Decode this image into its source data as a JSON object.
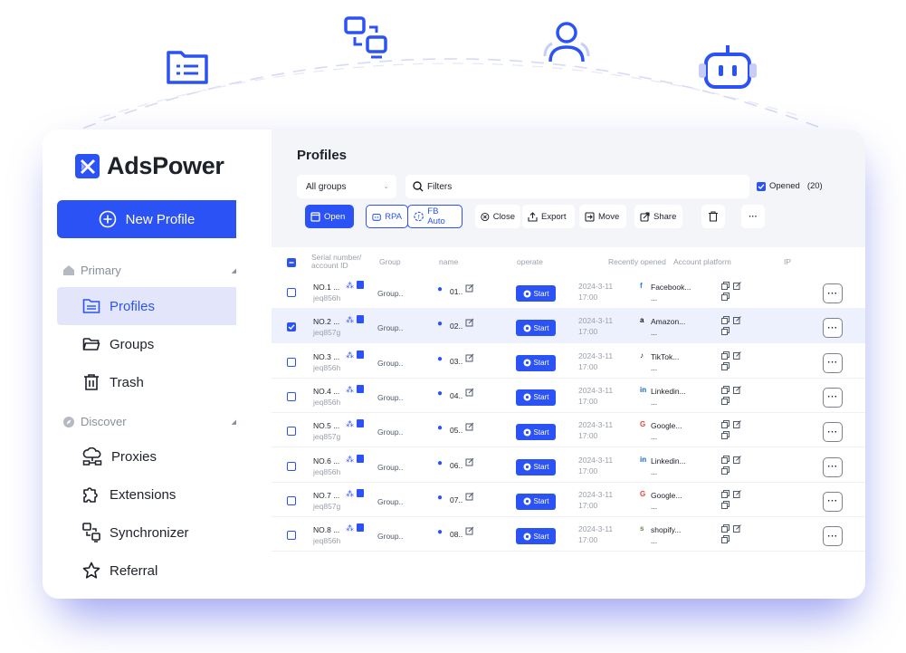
{
  "brand": {
    "name": "AdsPower",
    "color": "#2b52f5"
  },
  "top_icons": [
    "folder-list-icon",
    "sync-windows-icon",
    "user-icon",
    "robot-icon"
  ],
  "sidebar": {
    "new_profile": "New Profile",
    "sections": [
      {
        "label": "Primary",
        "icon": "home-icon"
      },
      {
        "label": "Discover",
        "icon": "compass-icon"
      }
    ],
    "primary_items": [
      {
        "label": "Profiles",
        "icon": "folder-icon",
        "active": true
      },
      {
        "label": "Groups",
        "icon": "open-folder-icon"
      },
      {
        "label": "Trash",
        "icon": "trash-icon"
      }
    ],
    "discover_items": [
      {
        "label": "Proxies",
        "icon": "cloud-network-icon"
      },
      {
        "label": "Extensions",
        "icon": "puzzle-icon"
      },
      {
        "label": "Synchronizer",
        "icon": "sync-windows-icon"
      },
      {
        "label": "Referral",
        "icon": "star-icon"
      }
    ]
  },
  "main": {
    "title": "Profiles",
    "group_select": "All groups",
    "filters_placeholder": "Filters",
    "opened_label": "Opened",
    "opened_count": "(20)",
    "toolbar": {
      "open": "Open",
      "rpa": "RPA",
      "fb_auto": "FB Auto",
      "close": "Close",
      "export": "Export",
      "move": "Move",
      "share": "Share",
      "more": "···"
    }
  },
  "table": {
    "headers": {
      "serial": "Serial number/\naccount ID",
      "group": "Group",
      "name": "name",
      "operate": "operate",
      "recent": "Recently opened",
      "platform": "Account platform",
      "ip": "IP"
    },
    "start_label": "Start",
    "more_label": "···",
    "rows": [
      {
        "no": "NO.1 ...",
        "id": "jeq856h",
        "group": "Group..",
        "name": "01..",
        "date": "2024-3-11",
        "time": "17:00",
        "platform": "Facebook...",
        "platform_icon": "f",
        "platform_color": "#1877f2",
        "selected": false
      },
      {
        "no": "NO.2 ...",
        "id": "jeq857g",
        "group": "Group..",
        "name": "02..",
        "date": "2024-3-11",
        "time": "17:00",
        "platform": "Amazon...",
        "platform_icon": "a",
        "platform_color": "#111111",
        "selected": true
      },
      {
        "no": "NO.3 ...",
        "id": "jeq856h",
        "group": "Group..",
        "name": "03..",
        "date": "2024-3-11",
        "time": "17:00",
        "platform": "TikTok...",
        "platform_icon": "♪",
        "platform_color": "#111111",
        "selected": false
      },
      {
        "no": "NO.4 ...",
        "id": "jeq856h",
        "group": "Group..",
        "name": "04..",
        "date": "2024-3-11",
        "time": "17:00",
        "platform": "Linkedin...",
        "platform_icon": "in",
        "platform_color": "#0a66c2",
        "selected": false
      },
      {
        "no": "NO.5 ...",
        "id": "jeq857g",
        "group": "Group..",
        "name": "05..",
        "date": "2024-3-11",
        "time": "17:00",
        "platform": "Google...",
        "platform_icon": "G",
        "platform_color": "#ea4335",
        "selected": false
      },
      {
        "no": "NO.6 ...",
        "id": "jeq856h",
        "group": "Group..",
        "name": "06..",
        "date": "2024-3-11",
        "time": "17:00",
        "platform": "Linkedin...",
        "platform_icon": "in",
        "platform_color": "#0a66c2",
        "selected": false
      },
      {
        "no": "NO.7 ...",
        "id": "jeq857g",
        "group": "Group..",
        "name": "07..",
        "date": "2024-3-11",
        "time": "17:00",
        "platform": "Google...",
        "platform_icon": "G",
        "platform_color": "#ea4335",
        "selected": false
      },
      {
        "no": "NO.8 ...",
        "id": "jeq856h",
        "group": "Group..",
        "name": "08..",
        "date": "2024-3-11",
        "time": "17:00",
        "platform": "shopify...",
        "platform_icon": "s",
        "platform_color": "#5e8e3e",
        "selected": false
      }
    ]
  }
}
